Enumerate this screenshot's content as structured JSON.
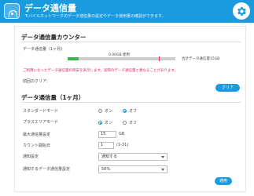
{
  "header": {
    "title": "データ通信量",
    "subtitle": "モバイルネットワークのデータ通信量の設定やデータ使用量の確認ができます。",
    "color": "#1a9be0"
  },
  "counter": {
    "title": "データ通信量カウンター",
    "usage_label": "データ通信量（1ヶ月)",
    "usage_text": "0.00GB 使用",
    "limit_text": "合計データ通信量15GB",
    "usage_fraction": 0.1,
    "warning_fraction": 0.85,
    "warning": "ご利用になったデータ通信量の目安を表示します。実際のデータ通信量と異なることがあります。",
    "last_clear_label": "前回のクリア:",
    "clear_button": "クリア"
  },
  "monthly": {
    "title": "データ通信量（1ヶ月）",
    "standard_mode_label": "スタンダードモード",
    "standard_mode_options": [
      "オン",
      "オフ"
    ],
    "standard_mode_selected": "オフ",
    "plus_area_mode_label": "プラスエリアモード",
    "plus_area_mode_options": [
      "オン",
      "オフ"
    ],
    "plus_area_mode_selected": "オン",
    "max_usage_label": "最大通信量設定",
    "max_usage_value": "15",
    "max_usage_unit": "GB",
    "count_start_label": "カウント開始日",
    "count_start_value": "1",
    "count_start_unit": "(1-31)",
    "notify_label": "通知設定",
    "notify_value": "通知する",
    "notify_threshold_label": "通知するデータ通信量設定",
    "notify_threshold_value": "50%",
    "apply_button": "適用"
  }
}
